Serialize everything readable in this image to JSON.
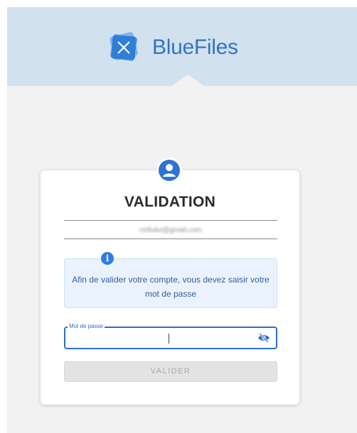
{
  "brand": {
    "name": "BlueFiles",
    "logo_icon": "bluefiles-logo-icon",
    "color": "#3273c4"
  },
  "card": {
    "avatar_icon": "user-avatar-icon",
    "title": "VALIDATION",
    "email": "m0luke@gmail.com",
    "info": {
      "icon": "info-icon",
      "text": "Afin de valider votre compte, vous devez saisir votre mot de passe"
    },
    "password": {
      "label": "Mot de passe",
      "value": "",
      "toggle_icon": "eye-slash-icon"
    },
    "submit_label": "VALIDER"
  },
  "colors": {
    "header_bg": "#d2e1ee",
    "accent": "#2d6fc5",
    "info_bg": "#eaf3fd",
    "page_bg": "#f2f2f2"
  }
}
